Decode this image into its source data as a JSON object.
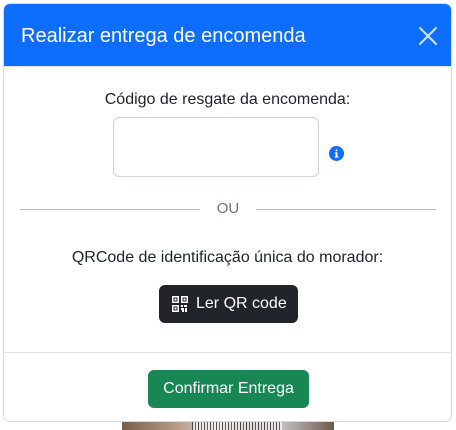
{
  "modal": {
    "title": "Realizar entrega de encomenda",
    "close_icon": "close-icon",
    "header_color": "#0d6efd"
  },
  "form": {
    "code_label": "Código de resgate da encomenda:",
    "code_value": "",
    "code_placeholder": "",
    "info_icon": "info-icon",
    "divider_text": "OU",
    "qr_label": "QRCode de identificação única do morador:",
    "qr_button_label": "Ler QR code",
    "qr_button_icon": "qr-code-icon",
    "qr_button_color": "#212529"
  },
  "footer": {
    "confirm_label": "Confirmar Entrega",
    "confirm_color": "#198754"
  }
}
